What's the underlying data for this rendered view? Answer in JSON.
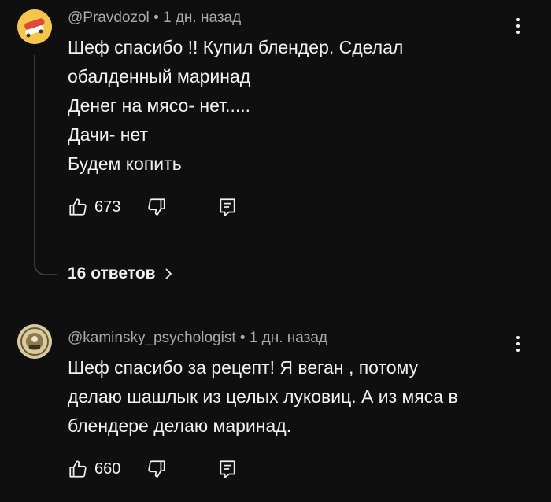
{
  "comments": [
    {
      "author": "@Pravdozol",
      "separator": "•",
      "time": "1 дн. назад",
      "lines": [
        "Шеф спасибо !! Купил блендер. Сделал",
        "обалденный маринад",
        "Денег на мясо- нет.....",
        "Дачи- нет",
        "Будем копить"
      ],
      "likes": "673",
      "avatar_icon": "skateboard-icon",
      "replies_label": "16 ответов"
    },
    {
      "author": "@kaminsky_psychologist",
      "separator": "•",
      "time": "1 дн. назад",
      "lines": [
        "Шеф спасибо за рецепт! Я веган , потому",
        "делаю шашлык из целых луковиц. А из мяса в",
        "блендере делаю маринад."
      ],
      "likes": "660",
      "avatar_icon": "emblem-icon"
    }
  ],
  "colors": {
    "background": "#0f0f0f",
    "text": "#f1f1f1",
    "secondary_text": "#aaaaaa",
    "avatar1_bg": "#f6c64a",
    "avatar2_bg": "#c9b98a"
  }
}
